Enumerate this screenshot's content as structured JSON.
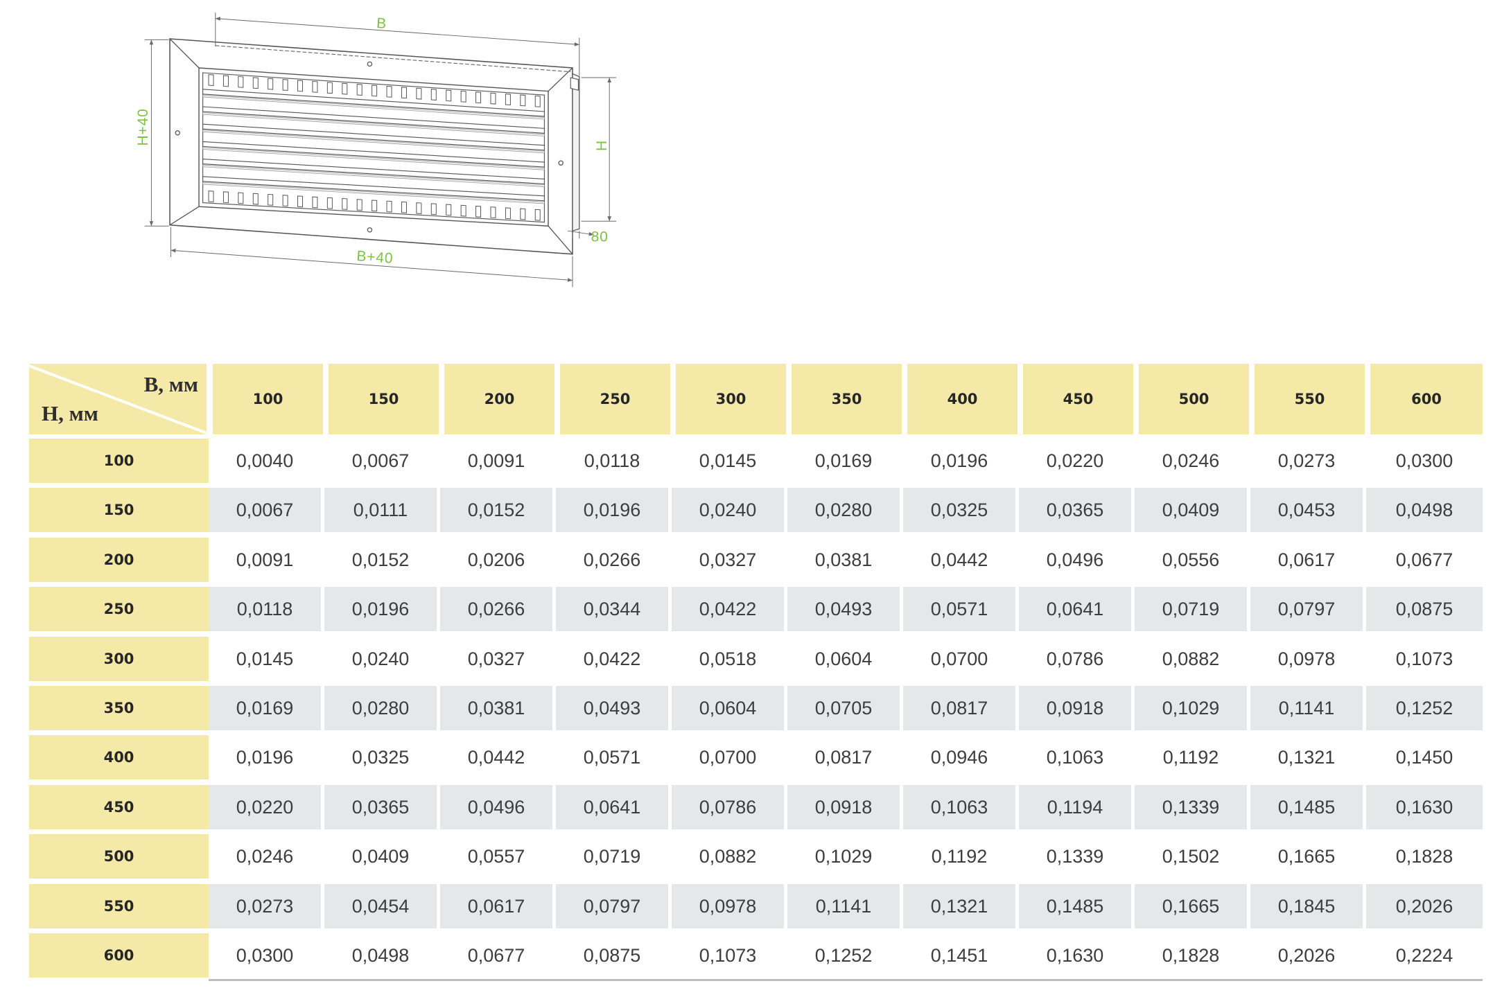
{
  "drawing": {
    "labels": {
      "width": "B",
      "outer_width": "B+40",
      "outer_height": "H+40",
      "height": "H",
      "depth": "80"
    }
  },
  "table": {
    "b_label": "B, мм",
    "h_label": "H, мм",
    "columns": [
      "100",
      "150",
      "200",
      "250",
      "300",
      "350",
      "400",
      "450",
      "500",
      "550",
      "600"
    ],
    "rows": [
      {
        "h": "100",
        "values": [
          "0,0040",
          "0,0067",
          "0,0091",
          "0,0118",
          "0,0145",
          "0,0169",
          "0,0196",
          "0,0220",
          "0,0246",
          "0,0273",
          "0,0300"
        ]
      },
      {
        "h": "150",
        "values": [
          "0,0067",
          "0,0111",
          "0,0152",
          "0,0196",
          "0,0240",
          "0,0280",
          "0,0325",
          "0,0365",
          "0,0409",
          "0,0453",
          "0,0498"
        ]
      },
      {
        "h": "200",
        "values": [
          "0,0091",
          "0,0152",
          "0,0206",
          "0,0266",
          "0,0327",
          "0,0381",
          "0,0442",
          "0,0496",
          "0,0556",
          "0,0617",
          "0,0677"
        ]
      },
      {
        "h": "250",
        "values": [
          "0,0118",
          "0,0196",
          "0,0266",
          "0,0344",
          "0,0422",
          "0,0493",
          "0,0571",
          "0,0641",
          "0,0719",
          "0,0797",
          "0,0875"
        ]
      },
      {
        "h": "300",
        "values": [
          "0,0145",
          "0,0240",
          "0,0327",
          "0,0422",
          "0,0518",
          "0,0604",
          "0,0700",
          "0,0786",
          "0,0882",
          "0,0978",
          "0,1073"
        ]
      },
      {
        "h": "350",
        "values": [
          "0,0169",
          "0,0280",
          "0,0381",
          "0,0493",
          "0,0604",
          "0,0705",
          "0,0817",
          "0,0918",
          "0,1029",
          "0,1141",
          "0,1252"
        ]
      },
      {
        "h": "400",
        "values": [
          "0,0196",
          "0,0325",
          "0,0442",
          "0,0571",
          "0,0700",
          "0,0817",
          "0,0946",
          "0,1063",
          "0,1192",
          "0,1321",
          "0,1450"
        ]
      },
      {
        "h": "450",
        "values": [
          "0,0220",
          "0,0365",
          "0,0496",
          "0,0641",
          "0,0786",
          "0,0918",
          "0,1063",
          "0,1194",
          "0,1339",
          "0,1485",
          "0,1630"
        ]
      },
      {
        "h": "500",
        "values": [
          "0,0246",
          "0,0409",
          "0,0557",
          "0,0719",
          "0,0882",
          "0,1029",
          "0,1192",
          "0,1339",
          "0,1502",
          "0,1665",
          "0,1828"
        ]
      },
      {
        "h": "550",
        "values": [
          "0,0273",
          "0,0454",
          "0,0617",
          "0,0797",
          "0,0978",
          "0,1141",
          "0,1321",
          "0,1485",
          "0,1665",
          "0,1845",
          "0,2026"
        ]
      },
      {
        "h": "600",
        "values": [
          "0,0300",
          "0,0498",
          "0,0677",
          "0,0875",
          "0,1073",
          "0,1252",
          "0,1451",
          "0,1630",
          "0,1828",
          "0,2026",
          "0,2224"
        ]
      }
    ]
  },
  "colors": {
    "header_fill": "#f4e9a6",
    "stripe_fill": "#e6e7e9",
    "dimension_label": "#7dc243",
    "outline": "#555555"
  }
}
